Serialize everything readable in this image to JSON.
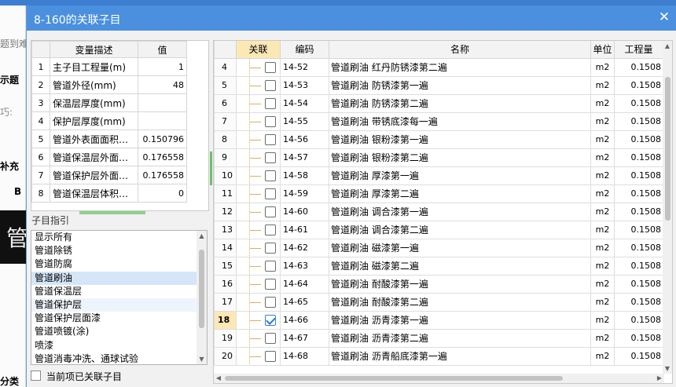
{
  "background": {
    "left_labels": [
      "题到难",
      "示题",
      "巧:",
      "补充",
      "B",
      "分类"
    ],
    "dark_text": "管"
  },
  "dialog": {
    "title": "8-160的关联子目",
    "close_glyph": "✕"
  },
  "variables": {
    "headers": [
      "变量描述",
      "值"
    ],
    "rows": [
      {
        "no": "1",
        "desc": "主子目工程量(m)",
        "value": "1"
      },
      {
        "no": "2",
        "desc": "管道外径(mm)",
        "value": "48"
      },
      {
        "no": "3",
        "desc": "保温层厚度(mm)",
        "value": ""
      },
      {
        "no": "4",
        "desc": "保护层厚度(mm)",
        "value": ""
      },
      {
        "no": "5",
        "desc": "管道外表面面积…",
        "value": "0.150796"
      },
      {
        "no": "6",
        "desc": "管道保温层外面…",
        "value": "0.176558"
      },
      {
        "no": "7",
        "desc": "管道保护层外面…",
        "value": "0.176558"
      },
      {
        "no": "8",
        "desc": "管道保温层体积…",
        "value": "0"
      }
    ]
  },
  "index": {
    "label": "子目指引",
    "items": [
      "显示所有",
      "管道除锈",
      "管道防腐",
      "管道刷油",
      "管道保温层",
      "管道保护层",
      "管道保护层面漆",
      "管道喷镀(涂)",
      "喷漆",
      "管道消毒冲洗、通球试验"
    ],
    "selected": 3,
    "highlight": 5,
    "checkbox_label": "当前项已关联子目"
  },
  "grid": {
    "headers": {
      "rel": "关联",
      "code": "编码",
      "name": "名称",
      "unit": "单位",
      "qty": "工程量"
    },
    "rows": [
      {
        "rn": "4",
        "code": "14-52",
        "name": "管道刷油 红丹防锈漆第二遍",
        "unit": "m2",
        "qty": "0.1508",
        "checked": false
      },
      {
        "rn": "5",
        "code": "14-53",
        "name": "管道刷油 防锈漆第一遍",
        "unit": "m2",
        "qty": "0.1508",
        "checked": false
      },
      {
        "rn": "6",
        "code": "14-54",
        "name": "管道刷油 防锈漆第二遍",
        "unit": "m2",
        "qty": "0.1508",
        "checked": false
      },
      {
        "rn": "7",
        "code": "14-55",
        "name": "管道刷油 带锈底漆每一遍",
        "unit": "m2",
        "qty": "0.1508",
        "checked": false
      },
      {
        "rn": "8",
        "code": "14-56",
        "name": "管道刷油 银粉漆第一遍",
        "unit": "m2",
        "qty": "0.1508",
        "checked": false
      },
      {
        "rn": "9",
        "code": "14-57",
        "name": "管道刷油 银粉漆第二遍",
        "unit": "m2",
        "qty": "0.1508",
        "checked": false
      },
      {
        "rn": "10",
        "code": "14-58",
        "name": "管道刷油 厚漆第一遍",
        "unit": "m2",
        "qty": "0.1508",
        "checked": false
      },
      {
        "rn": "11",
        "code": "14-59",
        "name": "管道刷油 厚漆第二遍",
        "unit": "m2",
        "qty": "0.1508",
        "checked": false
      },
      {
        "rn": "12",
        "code": "14-60",
        "name": "管道刷油 调合漆第一遍",
        "unit": "m2",
        "qty": "0.1508",
        "checked": false
      },
      {
        "rn": "13",
        "code": "14-61",
        "name": "管道刷油 调合漆第二遍",
        "unit": "m2",
        "qty": "0.1508",
        "checked": false
      },
      {
        "rn": "14",
        "code": "14-62",
        "name": "管道刷油 磁漆第一遍",
        "unit": "m2",
        "qty": "0.1508",
        "checked": false
      },
      {
        "rn": "15",
        "code": "14-63",
        "name": "管道刷油 磁漆第二遍",
        "unit": "m2",
        "qty": "0.1508",
        "checked": false
      },
      {
        "rn": "16",
        "code": "14-64",
        "name": "管道刷油 耐酸漆第一遍",
        "unit": "m2",
        "qty": "0.1508",
        "checked": false
      },
      {
        "rn": "17",
        "code": "14-65",
        "name": "管道刷油 耐酸漆第二遍",
        "unit": "m2",
        "qty": "0.1508",
        "checked": false
      },
      {
        "rn": "18",
        "code": "14-66",
        "name": "管道刷油 沥青漆第一遍",
        "unit": "m2",
        "qty": "0.1508",
        "checked": true
      },
      {
        "rn": "19",
        "code": "14-67",
        "name": "管道刷油 沥青漆第二遍",
        "unit": "m2",
        "qty": "0.1508",
        "checked": false
      },
      {
        "rn": "20",
        "code": "14-68",
        "name": "管道刷油 沥青船底漆第一遍",
        "unit": "m2",
        "qty": "0.1508",
        "checked": false
      }
    ],
    "current_row": 14
  },
  "colors": {
    "title_bar": "#4a90de",
    "highlight": "#fbe8b5",
    "selection": "#d4e6f7"
  }
}
